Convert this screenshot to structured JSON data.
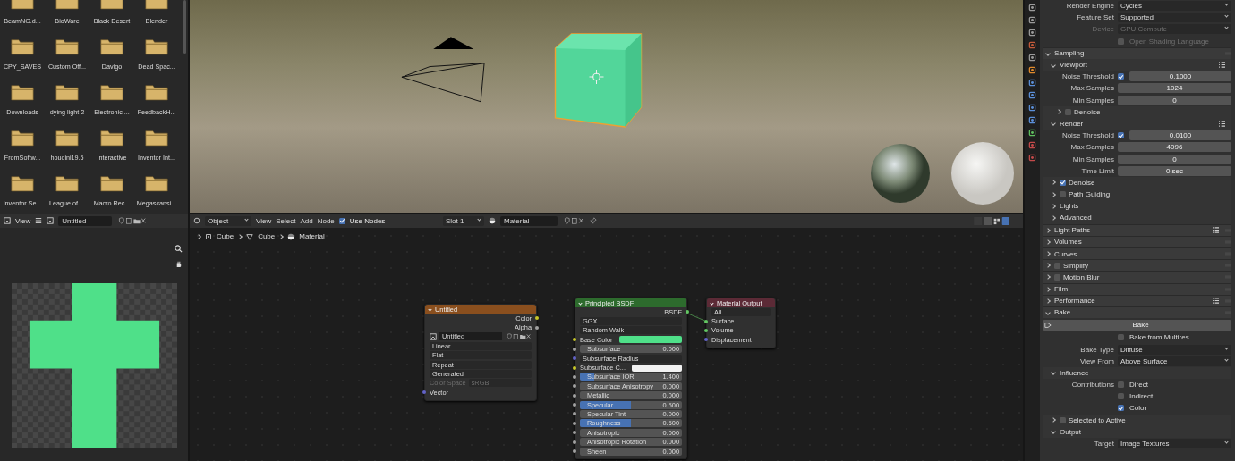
{
  "file_browser": {
    "folders": [
      "BeamNG.d...",
      "BioWare",
      "Black Desert",
      "Blender",
      "CPY_SAVES",
      "Custom Off...",
      "Davigo",
      "Dead Spac...",
      "Downloads",
      "dying light 2",
      "Electronic ...",
      "FeedbackH...",
      "FromSoftw...",
      "houdini19.5",
      "Interactive",
      "Inventor Int...",
      "Inventor Se...",
      "League of ...",
      "Macro Rec...",
      "Megascansi..."
    ]
  },
  "image_editor": {
    "header": {
      "view_menu": "View",
      "image_name": "Untitled"
    }
  },
  "node_editor": {
    "header": {
      "mode": "Object",
      "menus": [
        "View",
        "Select",
        "Add",
        "Node"
      ],
      "use_nodes": {
        "label": "Use Nodes",
        "checked": true
      },
      "slot": "Slot 1",
      "material": "Material"
    },
    "breadcrumbs": [
      {
        "kind": "object",
        "label": "Cube"
      },
      {
        "kind": "mesh",
        "label": "Cube"
      },
      {
        "kind": "material",
        "label": "Material"
      }
    ],
    "nodes": [
      {
        "title": "Untitled",
        "color": "#8a4f1e",
        "rows": [
          {
            "kind": "output",
            "label": "Color",
            "socket": {
              "color": "#c7c729"
            }
          },
          {
            "kind": "output",
            "label": "Alpha",
            "socket": {
              "color": "#a1a1a1"
            }
          },
          {
            "kind": "image",
            "value": "Untitled"
          },
          {
            "kind": "dropdown",
            "value": "Linear"
          },
          {
            "kind": "dropdown",
            "value": "Flat"
          },
          {
            "kind": "dropdown",
            "value": "Repeat"
          },
          {
            "kind": "dropdown",
            "value": "Generated"
          },
          {
            "kind": "field",
            "label": "Color Space",
            "value": "sRGB",
            "disabled": true
          },
          {
            "kind": "input",
            "label": "Vector",
            "socket": {
              "color": "#6363c7"
            }
          }
        ]
      },
      {
        "title": "Principled BSDF",
        "color": "#2d6b2d",
        "rows": [
          {
            "kind": "output",
            "label": "BSDF",
            "socket": {
              "color": "#63c763"
            }
          },
          {
            "kind": "dropdown",
            "value": "GGX"
          },
          {
            "kind": "dropdown",
            "value": "Random Walk"
          },
          {
            "kind": "color",
            "label": "Base Color",
            "socket": {
              "color": "#c7c729"
            },
            "color": "#4fe089"
          },
          {
            "kind": "slider",
            "label": "Subsurface",
            "value": "0.000",
            "level": 0,
            "socket": {
              "color": "#a1a1a1"
            }
          },
          {
            "kind": "dropdown_input",
            "label": "Subsurface Radius",
            "socket": {
              "color": "#6363c7"
            }
          },
          {
            "kind": "color",
            "label": "Subsurface C...",
            "socket": {
              "color": "#c7c729"
            },
            "color": "#f2f2f2"
          },
          {
            "kind": "slider",
            "label": "Subsurface IOR",
            "value": "1.400",
            "level": 0.14,
            "socket": {
              "color": "#a1a1a1"
            }
          },
          {
            "kind": "slider",
            "label": "Subsurface Anisotropy",
            "value": "0.000",
            "level": 0,
            "socket": {
              "color": "#a1a1a1"
            }
          },
          {
            "kind": "slider",
            "label": "Metallic",
            "value": "0.000",
            "level": 0,
            "socket": {
              "color": "#a1a1a1"
            }
          },
          {
            "kind": "slider",
            "label": "Specular",
            "value": "0.500",
            "level": 0.5,
            "socket": {
              "color": "#a1a1a1"
            }
          },
          {
            "kind": "slider",
            "label": "Specular Tint",
            "value": "0.000",
            "level": 0,
            "socket": {
              "color": "#a1a1a1"
            }
          },
          {
            "kind": "slider",
            "label": "Roughness",
            "value": "0.500",
            "level": 0.5,
            "socket": {
              "color": "#a1a1a1"
            }
          },
          {
            "kind": "slider",
            "label": "Anisotropic",
            "value": "0.000",
            "level": 0,
            "socket": {
              "color": "#a1a1a1"
            }
          },
          {
            "kind": "slider",
            "label": "Anisotropic Rotation",
            "value": "0.000",
            "level": 0,
            "socket": {
              "color": "#a1a1a1"
            }
          },
          {
            "kind": "slider",
            "label": "Sheen",
            "value": "0.000",
            "level": 0,
            "socket": {
              "color": "#a1a1a1"
            }
          }
        ]
      },
      {
        "title": "Material Output",
        "color": "#5c2a36",
        "rows": [
          {
            "kind": "dropdown",
            "value": "All"
          },
          {
            "kind": "input",
            "label": "Surface",
            "socket": {
              "color": "#63c763"
            }
          },
          {
            "kind": "input",
            "label": "Volume",
            "socket": {
              "color": "#63c763"
            }
          },
          {
            "kind": "input",
            "label": "Displacement",
            "socket": {
              "color": "#6363c7"
            }
          }
        ]
      }
    ]
  },
  "properties": {
    "items": [
      {
        "kind": "field",
        "label": "Render Engine",
        "value": "Cycles",
        "dropdown": true
      },
      {
        "kind": "field",
        "label": "Feature Set",
        "value": "Supported",
        "dropdown": true
      },
      {
        "kind": "field",
        "label": "Device",
        "value": "GPU Compute",
        "dropdown": true,
        "disabled": true
      },
      {
        "kind": "check",
        "label": "Open Shading Language",
        "checked": false,
        "disabled": true
      },
      {
        "kind": "panel",
        "label": "Sampling",
        "expanded": true,
        "children": [
          {
            "kind": "panel",
            "label": "Viewport",
            "expanded": true,
            "presets": true,
            "children": [
              {
                "kind": "field",
                "label": "Noise Threshold",
                "value": "0.1000",
                "checked": true
              },
              {
                "kind": "field",
                "label": "Max Samples",
                "value": "1024"
              },
              {
                "kind": "field",
                "label": "Min Samples",
                "value": "0"
              },
              {
                "kind": "panel",
                "label": "Denoise",
                "checked": false,
                "expanded": false
              }
            ]
          },
          {
            "kind": "panel",
            "label": "Render",
            "expanded": true,
            "presets": true,
            "children": [
              {
                "kind": "field",
                "label": "Noise Threshold",
                "value": "0.0100",
                "checked": true
              },
              {
                "kind": "field",
                "label": "Max Samples",
                "value": "4096"
              },
              {
                "kind": "field",
                "label": "Min Samples",
                "value": "0"
              },
              {
                "kind": "field",
                "label": "Time Limit",
                "value": "0 sec"
              }
            ]
          },
          {
            "kind": "panel",
            "label": "Denoise",
            "checked": true,
            "expanded": false
          },
          {
            "kind": "panel",
            "label": "Path Guiding",
            "checked": false,
            "expanded": false
          },
          {
            "kind": "panel",
            "label": "Lights",
            "expanded": false
          },
          {
            "kind": "panel",
            "label": "Advanced",
            "expanded": false
          }
        ]
      },
      {
        "kind": "panel",
        "label": "Light Paths",
        "expanded": false,
        "presets": true
      },
      {
        "kind": "panel",
        "label": "Volumes",
        "expanded": false
      },
      {
        "kind": "panel",
        "label": "Curves",
        "expanded": false
      },
      {
        "kind": "panel",
        "label": "Simplify",
        "checked": false,
        "expanded": false
      },
      {
        "kind": "panel",
        "label": "Motion Blur",
        "checked": false,
        "expanded": false
      },
      {
        "kind": "panel",
        "label": "Film",
        "expanded": false
      },
      {
        "kind": "panel",
        "label": "Performance",
        "expanded": false,
        "presets": true
      },
      {
        "kind": "panel",
        "label": "Bake",
        "expanded": true,
        "children": [
          {
            "kind": "button",
            "label": "Bake"
          },
          {
            "kind": "check",
            "label": "Bake from Multires",
            "checked": false
          },
          {
            "kind": "field",
            "label": "Bake Type",
            "value": "Diffuse",
            "dropdown": true
          },
          {
            "kind": "field",
            "label": "View From",
            "value": "Above Surface",
            "dropdown": true
          },
          {
            "kind": "panel",
            "label": "Influence",
            "expanded": true,
            "children": [
              {
                "kind": "check",
                "caption": "Contributions",
                "label": "Direct",
                "checked": false
              },
              {
                "kind": "check",
                "label": "Indirect",
                "checked": false
              },
              {
                "kind": "check",
                "label": "Color",
                "checked": true
              }
            ]
          },
          {
            "kind": "panel",
            "label": "Selected to Active",
            "checked": false,
            "expanded": false
          },
          {
            "kind": "panel",
            "label": "Output",
            "expanded": true,
            "children": [
              {
                "kind": "field",
                "label": "Target",
                "value": "Image Textures",
                "dropdown": true
              }
            ]
          }
        ]
      }
    ]
  }
}
